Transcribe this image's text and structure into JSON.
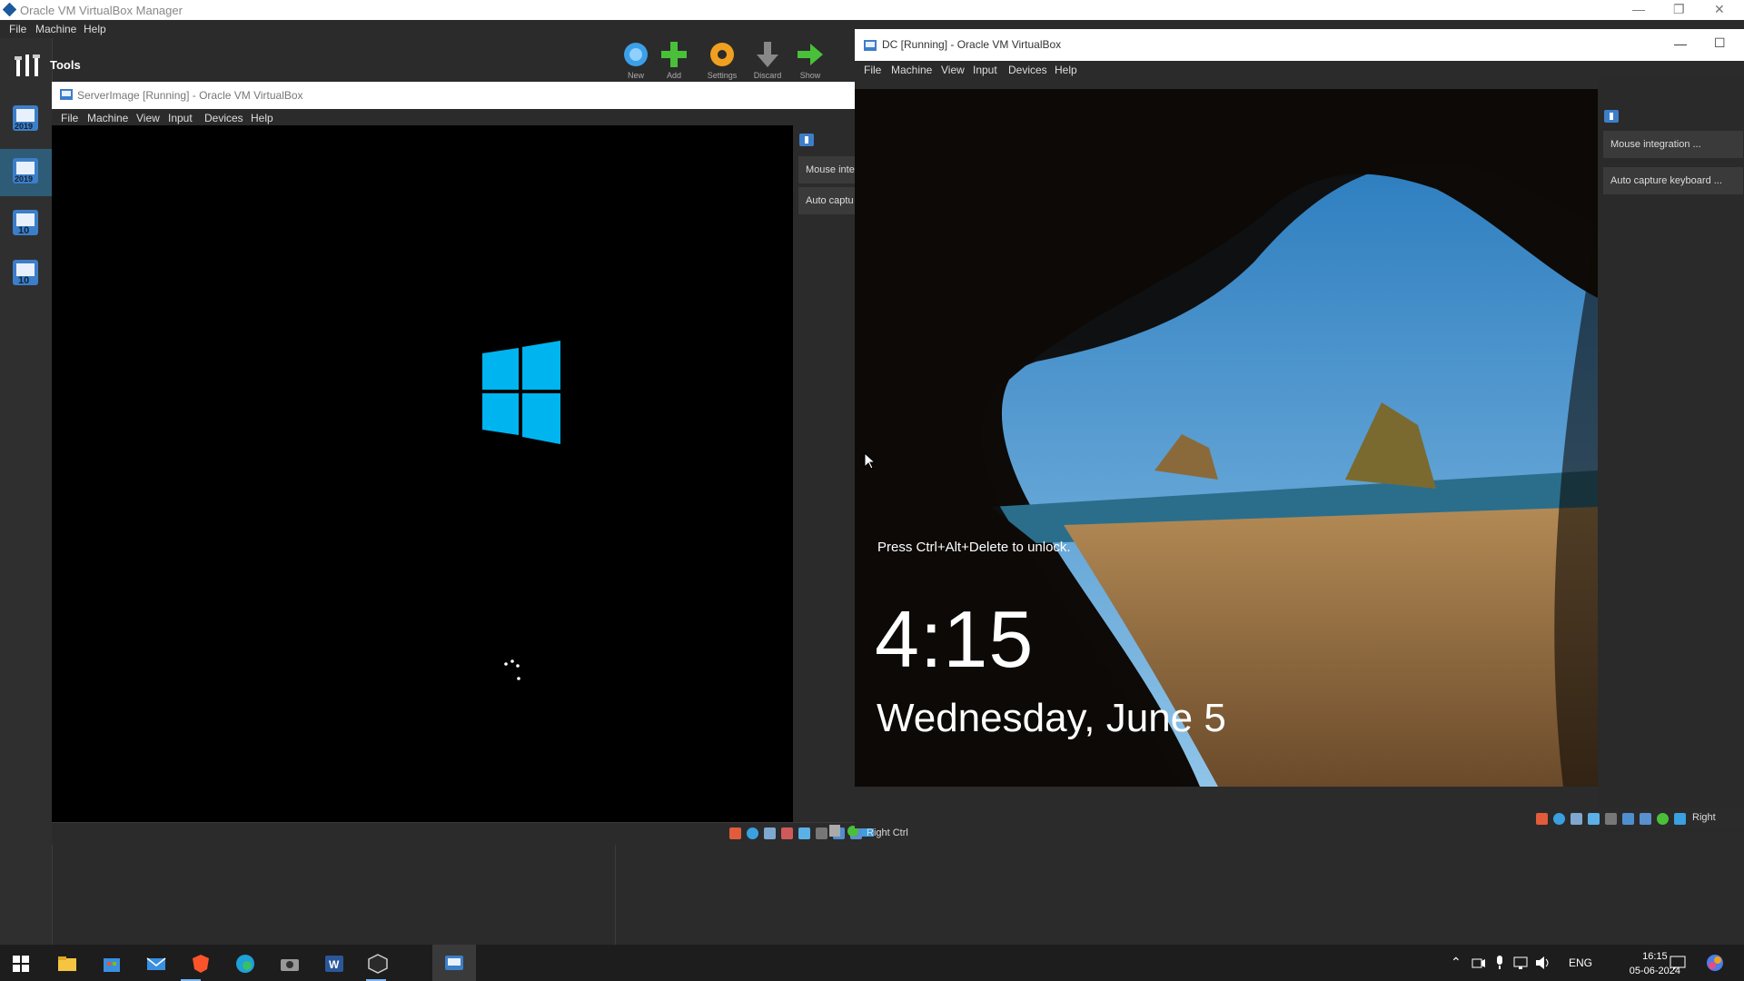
{
  "manager": {
    "title": "Oracle VM VirtualBox Manager",
    "menu": [
      "File",
      "Machine",
      "Help"
    ],
    "tools_label": "Tools",
    "vm_badges": [
      "2019",
      "2019",
      "10",
      "10"
    ],
    "toolbar": [
      "New",
      "Add",
      "Settings",
      "Discard",
      "Show"
    ]
  },
  "server_window": {
    "title": "ServerImage [Running] - Oracle VM VirtualBox",
    "menu": [
      "File",
      "Machine",
      "View",
      "Input",
      "Devices",
      "Help"
    ],
    "panel_items": [
      "Mouse inte",
      "Auto captu"
    ],
    "host_key": "Right Ctrl"
  },
  "dc_window": {
    "title": "DC [Running] - Oracle VM VirtualBox",
    "menu": [
      "File",
      "Machine",
      "View",
      "Input",
      "Devices",
      "Help"
    ],
    "panel_items": [
      "Mouse integration ...",
      "Auto capture keyboard ..."
    ],
    "host_key": "Right",
    "lock_message": "Press Ctrl+Alt+Delete to unlock.",
    "lock_time": "4:15",
    "lock_date": "Wednesday, June 5"
  },
  "taskbar": {
    "language": "ENG",
    "time": "16:15",
    "date": "05-06-2024"
  },
  "colors": {
    "windows_logo": "#00b4f0",
    "app_dark": "#2b2b2b",
    "title_white": "#ffffff",
    "taskbar": "#1d1d1d"
  }
}
